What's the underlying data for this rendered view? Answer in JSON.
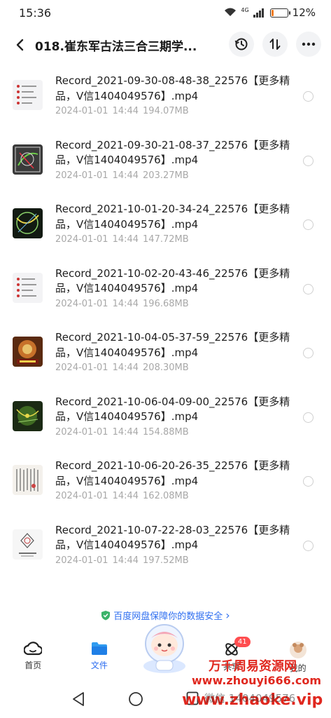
{
  "status_bar": {
    "time": "15:36",
    "network": "4G",
    "battery_percent": "12%",
    "battery_level": 0.12,
    "battery_color": "#f07a1a"
  },
  "header": {
    "title": "018.崔东军古法三合三期学...",
    "icons": [
      "back-arrow-icon",
      "history-icon",
      "sort-icon",
      "more-icon"
    ]
  },
  "files": [
    {
      "name": "Record_2021-09-30-08-48-38_22576【更多精品，V信1404049576】.mp4",
      "date": "2024-01-01",
      "time": "14:44",
      "size": "194.07MB"
    },
    {
      "name": "Record_2021-09-30-21-08-37_22576【更多精品，V信1404049576】.mp4",
      "date": "2024-01-01",
      "time": "14:44",
      "size": "203.27MB"
    },
    {
      "name": "Record_2021-10-01-20-34-24_22576【更多精品，V信1404049576】.mp4",
      "date": "2024-01-01",
      "time": "14:44",
      "size": "147.72MB"
    },
    {
      "name": "Record_2021-10-02-20-43-46_22576【更多精品，V信1404049576】.mp4",
      "date": "2024-01-01",
      "time": "14:44",
      "size": "196.68MB"
    },
    {
      "name": "Record_2021-10-04-05-37-59_22576【更多精品，V信1404049576】.mp4",
      "date": "2024-01-01",
      "time": "14:44",
      "size": "208.30MB"
    },
    {
      "name": "Record_2021-10-06-04-09-00_22576【更多精品，V信1404049576】.mp4",
      "date": "2024-01-01",
      "time": "14:44",
      "size": "154.88MB"
    },
    {
      "name": "Record_2021-10-06-20-26-35_22576【更多精品，V信1404049576】.mp4",
      "date": "2024-01-01",
      "time": "14:44",
      "size": "162.08MB"
    },
    {
      "name": "Record_2021-10-07-22-28-03_22576【更多精品，V信1404049576】.mp4",
      "date": "2024-01-01",
      "time": "14:44",
      "size": "197.52MB"
    }
  ],
  "notice": {
    "text": "百度网盘保障你的数据安全",
    "arrow": "›"
  },
  "bottom_nav": [
    {
      "label": "首页",
      "icon": "home-cloud-icon",
      "active": false
    },
    {
      "label": "文件",
      "icon": "folder-icon",
      "active": true
    },
    {
      "label": "共享",
      "icon": "share-icon",
      "active": false,
      "badge": "41"
    },
    {
      "label": "我的",
      "icon": "avatar-icon",
      "active": false
    }
  ],
  "watermark": {
    "line1": "万千周易资源网",
    "line2": "www.zhouyi666.com",
    "line3": "www.zhaoke.vip",
    "partial_text": "微信 1404049576"
  },
  "accent_color": "#2f6ff0"
}
